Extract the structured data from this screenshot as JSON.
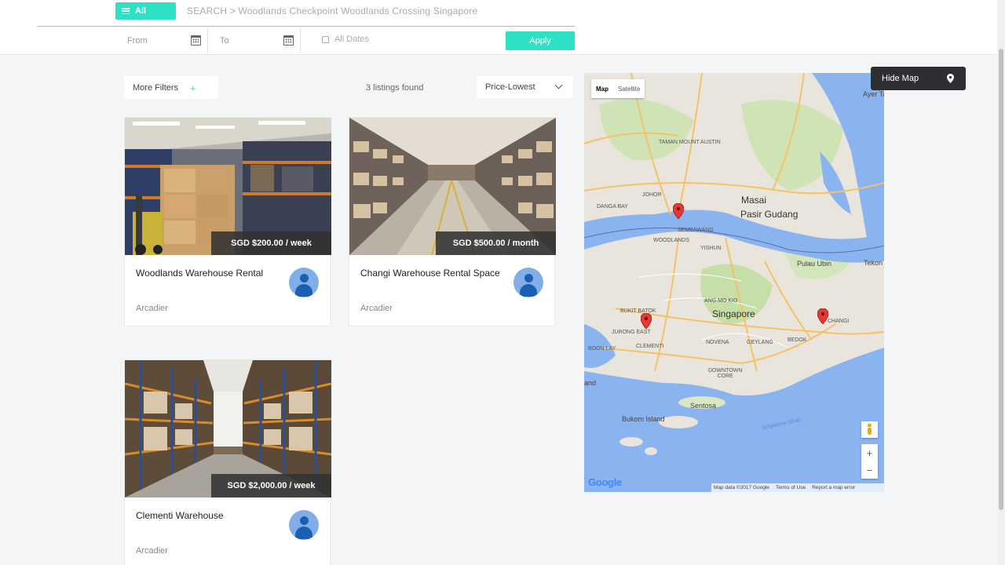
{
  "header": {
    "all_label": "All",
    "breadcrumb": "SEARCH > Woodlands Checkpoint Woodlands Crossing Singapore",
    "from_label": "From",
    "to_label": "To",
    "all_dates_label": "All Dates",
    "apply_label": "Apply"
  },
  "filters": {
    "more_filters_label": "More Filters",
    "plus_symbol": "+",
    "listings_found": "3 listings found",
    "sort_value": "Price-Lowest"
  },
  "listings": [
    {
      "title": "Woodlands Warehouse Rental",
      "price": "SGD $200.00 / week",
      "seller": "Arcadier"
    },
    {
      "title": "Changi Warehouse Rental Space",
      "price": "SGD $500.00 / month",
      "seller": "Arcadier"
    },
    {
      "title": "Clementi Warehouse",
      "price": "SGD $2,000.00 / week",
      "seller": "Arcadier"
    }
  ],
  "map": {
    "hide_map_label": "Hide Map",
    "type_map": "Map",
    "type_satellite": "Satellite",
    "zoom_in": "+",
    "zoom_out": "−",
    "google_logo": "Google",
    "attribution": [
      "Map data ©2017 Google",
      "Terms of Use",
      "Report a map error"
    ],
    "labels": {
      "singapore": "Singapore",
      "masai": "Masai",
      "pasir_gudang": "Pasir Gudang",
      "pulau_ubin": "Pulau Ubin",
      "tekong": "Tekon",
      "taman_mount_austin": "TAMAN\nMOUNT AUSTIN",
      "johor": "JOHOR",
      "danga_bay": "DANGA BAY",
      "sembawang": "SEMBAWANG",
      "woodlands": "WOODLANDS",
      "yishun": "YISHUN",
      "bukit_batok": "BUKIT BATOK",
      "jurong_east": "JURONG EAST",
      "clementi": "CLEMENTI",
      "boon_lay": "BOON LAY",
      "novena": "NOVENA",
      "geylang": "GEYLANG",
      "bedok": "BEDOK",
      "changi": "CHANGI",
      "downtown_core": "DOWNTOWN\nCORE",
      "ang_mo_kio": "ANG MO KIO",
      "sentosa": "Sentosa",
      "bukom_island": "Bukom Island",
      "singapore_strait": "Singapore Strait",
      "ayer_ta": "Ayer Ta",
      "and": "and"
    }
  },
  "colors": {
    "accent": "#2ee0c4",
    "dark_button": "#2d2f33",
    "price_overlay": "#333333",
    "water": "#8ab4f0",
    "pin": "#e53935"
  }
}
